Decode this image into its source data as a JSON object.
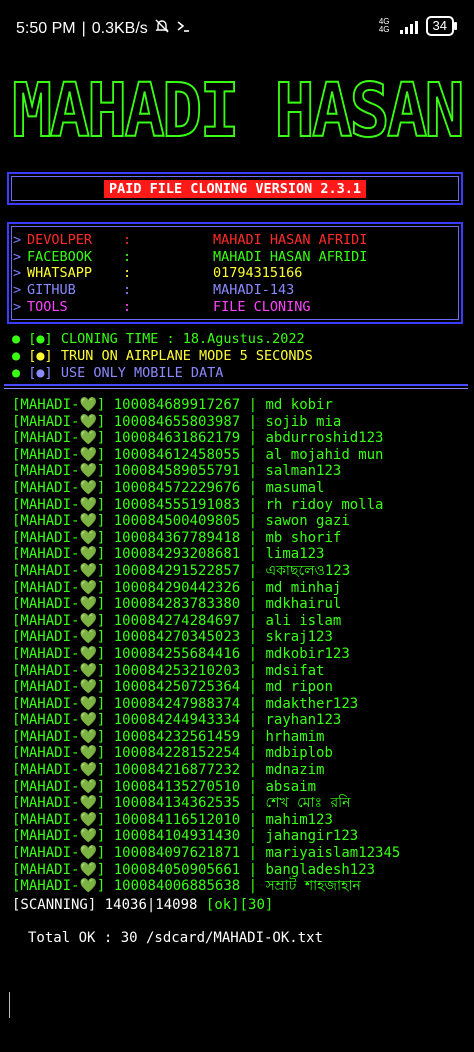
{
  "status_bar": {
    "time": "5:50 PM",
    "separator": "|",
    "speed": "0.3KB/s",
    "network_type": "4G",
    "network_sub": "4G",
    "battery": "34"
  },
  "banner": {
    "text": "MAHADI HASAN"
  },
  "version": {
    "label": "PAID FILE CLONING VERSION 2.3.1"
  },
  "info": {
    "rows": [
      {
        "arrow": ">",
        "key": "DEVOLPER",
        "colon": ":",
        "value": "MAHADI HASAN AFRIDI",
        "key_color": "#ff2a2a",
        "value_color": "#ff2a2a"
      },
      {
        "arrow": ">",
        "key": "FACEBOOK",
        "colon": ":",
        "value": "MAHADI HASAN AFRIDI",
        "key_color": "#39ff14",
        "value_color": "#39ff14"
      },
      {
        "arrow": ">",
        "key": "WHATSAPP",
        "colon": ":",
        "value": "01794315166",
        "key_color": "#ffff33",
        "value_color": "#ffff33"
      },
      {
        "arrow": ">",
        "key": "GITHUB",
        "colon": ":",
        "value": "MAHADI-143",
        "key_color": "#8a8aff",
        "value_color": "#8a8aff"
      },
      {
        "arrow": ">",
        "key": "TOOLS",
        "colon": ":",
        "value": "FILE CLONING",
        "key_color": "#ff44ff",
        "value_color": "#ff44ff"
      }
    ]
  },
  "messages": [
    {
      "prefix": "[●]",
      "text": "CLONING TIME : 18.Agustus.2022",
      "color": "#39ff14"
    },
    {
      "prefix": "[●]",
      "text": "TRUN ON AIRPLANE MODE 5 SECONDS",
      "color": "#ffff33"
    },
    {
      "prefix": "[●]",
      "text": "USE ONLY MOBILE DATA",
      "color": "#8a8aff"
    }
  ],
  "results": {
    "tag": "[MAHADI-",
    "heart": "💚",
    "tag_close": "]",
    "rows": [
      {
        "id": "100084689917267",
        "name": "md kobir"
      },
      {
        "id": "100084655803987",
        "name": "sojib mia"
      },
      {
        "id": "100084631862179",
        "name": "abdurroshid123"
      },
      {
        "id": "100084612458055",
        "name": "al mojahid mun"
      },
      {
        "id": "100084589055791",
        "name": "salman123"
      },
      {
        "id": "100084572229676",
        "name": "masumal"
      },
      {
        "id": "100084555191083",
        "name": "rh ridoy molla"
      },
      {
        "id": "100084500409805",
        "name": "sawon gazi"
      },
      {
        "id": "100084367789418",
        "name": "mb shorif"
      },
      {
        "id": "100084293208681",
        "name": "lima123"
      },
      {
        "id": "100084291522857",
        "name": "একাছলেও123"
      },
      {
        "id": "100084290442326",
        "name": "md minhaj"
      },
      {
        "id": "100084283783380",
        "name": "mdkhairul"
      },
      {
        "id": "100084274284697",
        "name": "ali islam"
      },
      {
        "id": "100084270345023",
        "name": "skraj123"
      },
      {
        "id": "100084255684416",
        "name": "mdkobir123"
      },
      {
        "id": "100084253210203",
        "name": "mdsifat"
      },
      {
        "id": "100084250725364",
        "name": "md ripon"
      },
      {
        "id": "100084247988374",
        "name": "mdakther123"
      },
      {
        "id": "100084244943334",
        "name": "rayhan123"
      },
      {
        "id": "100084232561459",
        "name": "hrhamim"
      },
      {
        "id": "100084228152254",
        "name": "mdbiplob"
      },
      {
        "id": "100084216877232",
        "name": "mdnazim"
      },
      {
        "id": "100084135270510",
        "name": "absaim"
      },
      {
        "id": "100084134362535",
        "name": "শেখ মোঃ রনি"
      },
      {
        "id": "100084116512010",
        "name": "mahim123"
      },
      {
        "id": "100084104931430",
        "name": "jahangir123"
      },
      {
        "id": "100084097621871",
        "name": "mariyaislam12345"
      },
      {
        "id": "100084050905661",
        "name": "bangladesh123"
      },
      {
        "id": "100084006885638",
        "name": "সম্রাট শাহজাহান"
      }
    ]
  },
  "scan": {
    "label": "[SCANNING]",
    "progress": "14036|14098",
    "ok": "[ok][30]"
  },
  "total": {
    "text": "Total OK :  30  /sdcard/MAHADI-OK.txt"
  },
  "colors": {
    "background": "#000000",
    "green": "#39ff14",
    "border_blue": "#3b3bff",
    "red_label": "#ff1a1a"
  }
}
